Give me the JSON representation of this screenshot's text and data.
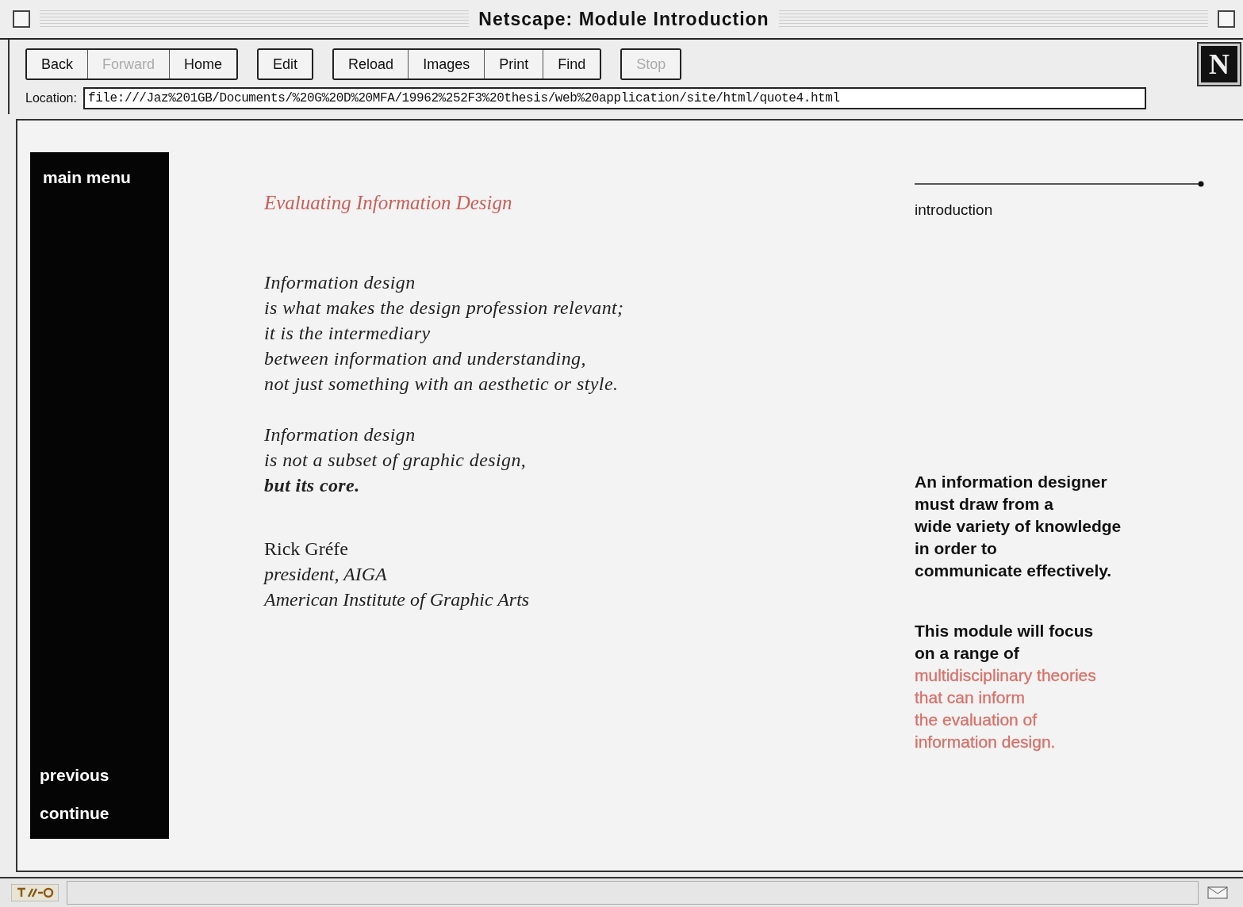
{
  "window": {
    "title": "Netscape: Module Introduction"
  },
  "toolbar": {
    "groups": [
      [
        {
          "label": "Back",
          "disabled": false
        },
        {
          "label": "Forward",
          "disabled": true
        },
        {
          "label": "Home",
          "disabled": false
        }
      ],
      [
        {
          "label": "Edit",
          "disabled": false
        }
      ],
      [
        {
          "label": "Reload",
          "disabled": false
        },
        {
          "label": "Images",
          "disabled": false
        },
        {
          "label": "Print",
          "disabled": false
        },
        {
          "label": "Find",
          "disabled": false
        }
      ],
      [
        {
          "label": "Stop",
          "disabled": true
        }
      ]
    ],
    "logo": "N"
  },
  "location": {
    "label": "Location:",
    "value": "file:///Jaz%201GB/Documents/%20G%20D%20MFA/19962%252F3%20thesis/web%20application/site/html/quote4.html"
  },
  "sidebar": {
    "title": "main menu",
    "links": [
      "previous",
      "continue"
    ]
  },
  "page": {
    "heading": "Evaluating Information Design",
    "quote": [
      [
        "Information design",
        "is what makes the design profession relevant;",
        "it is the intermediary",
        "between information and understanding,",
        "not just something with an aesthetic or style."
      ],
      [
        "Information design",
        "is not a subset of graphic design,",
        "**but its core.**"
      ]
    ],
    "attribution": [
      {
        "text": "Rick Gréfe",
        "italic": false
      },
      {
        "text": "president, AIGA",
        "italic": true
      },
      {
        "text": "American Institute of Graphic Arts",
        "italic": true
      }
    ],
    "section": "introduction",
    "notes": [
      [
        {
          "text": "An information designer",
          "accent": false
        },
        {
          "text": "must draw from a",
          "accent": false
        },
        {
          "text": "wide variety of knowledge",
          "accent": false
        },
        {
          "text": "in order to",
          "accent": false
        },
        {
          "text": "communicate effectively.",
          "accent": false
        }
      ],
      [
        {
          "text": "This module will focus",
          "accent": false
        },
        {
          "text": "on a range of",
          "accent": false
        },
        {
          "text": "multidisciplinary theories",
          "accent": true
        },
        {
          "text": "that can inform",
          "accent": true
        },
        {
          "text": "the evaluation of",
          "accent": true
        },
        {
          "text": "information design.",
          "accent": true
        }
      ]
    ]
  }
}
